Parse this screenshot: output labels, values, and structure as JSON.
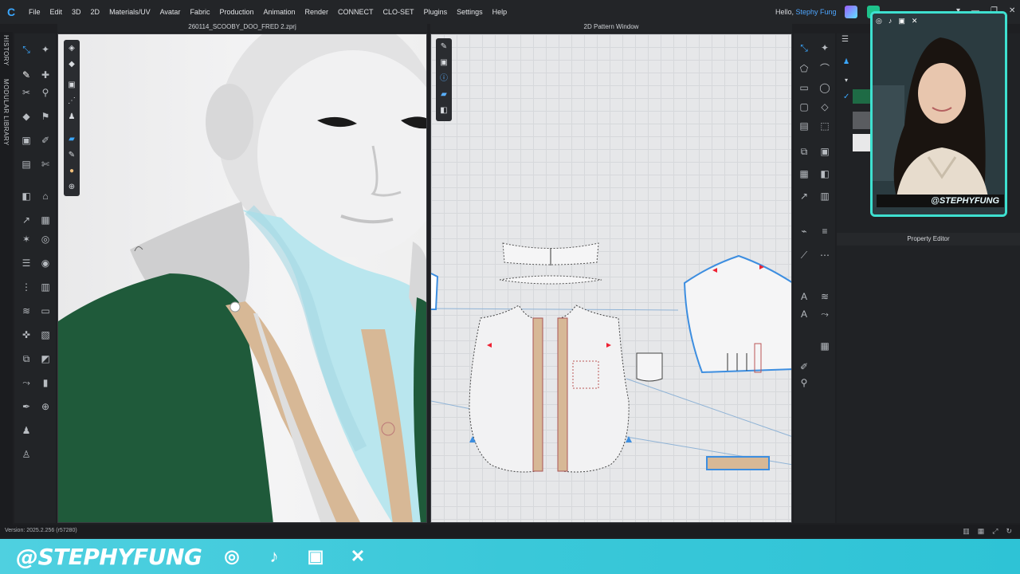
{
  "menu": [
    "File",
    "Edit",
    "3D",
    "2D",
    "Materials/UV",
    "Avatar",
    "Fabric",
    "Production",
    "Animation",
    "Render",
    "CONNECT",
    "CLO-SET",
    "Plugins",
    "Settings",
    "Help"
  ],
  "greeting": {
    "prefix": "Hello, ",
    "user": "Stephy Fung"
  },
  "sidebar_tabs": [
    "HISTORY",
    "MODULAR LIBRARY"
  ],
  "viewport": {
    "title": "260114_SCOOBY_DOO_FRED 2.zprj"
  },
  "pattern_window": {
    "title": "2D Pattern Window"
  },
  "property_editor": {
    "title": "Property Editor"
  },
  "webcam": {
    "handle": "@STEPHYFUNG"
  },
  "status": {
    "version": "Version: 2025.2.256 (r57280)"
  },
  "banner": {
    "handle": "@STEPHYFUNG",
    "socials": [
      "instagram-icon",
      "tiktok-icon",
      "twitch-icon",
      "x-icon"
    ]
  },
  "colors": {
    "accent": "#4ea6ff",
    "banner": "#3ac8d9",
    "jacket": "#1f5a3a",
    "collar": "#b9e6ee"
  }
}
